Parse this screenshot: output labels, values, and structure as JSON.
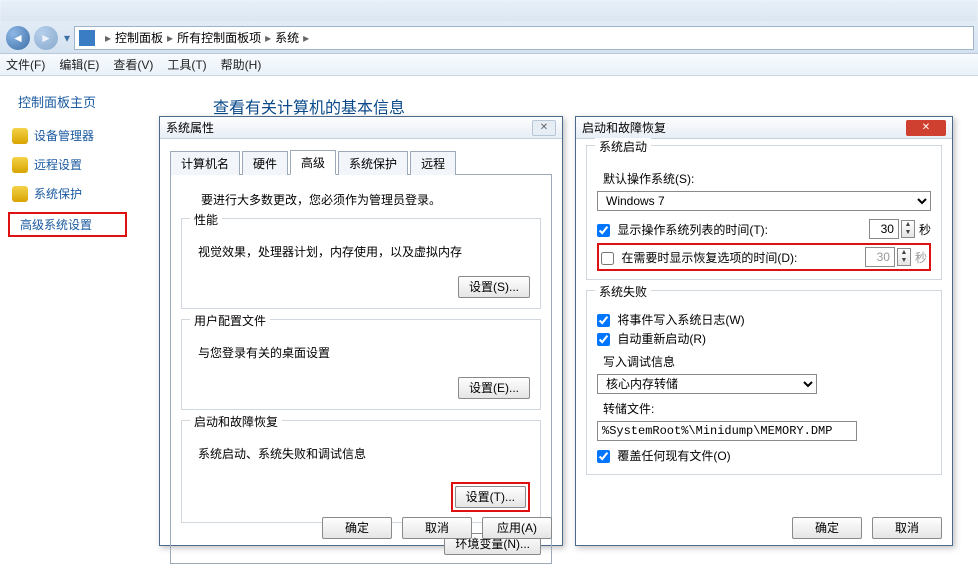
{
  "addrbar": {
    "seg1": "控制面板",
    "seg2": "所有控制面板项",
    "seg3": "系统"
  },
  "menu": {
    "file": "文件(F)",
    "edit": "编辑(E)",
    "view": "查看(V)",
    "tools": "工具(T)",
    "help": "帮助(H)"
  },
  "sidebar": {
    "title": "控制面板主页",
    "items": [
      "设备管理器",
      "远程设置",
      "系统保护",
      "高级系统设置"
    ]
  },
  "main": {
    "title": "查看有关计算机的基本信息"
  },
  "sysprop": {
    "title": "系统属性",
    "tabs": [
      "计算机名",
      "硬件",
      "高级",
      "系统保护",
      "远程"
    ],
    "note": "要进行大多数更改，您必须作为管理员登录。",
    "perf": {
      "legend": "性能",
      "desc": "视觉效果，处理器计划，内存使用，以及虚拟内存",
      "btn": "设置(S)..."
    },
    "user": {
      "legend": "用户配置文件",
      "desc": "与您登录有关的桌面设置",
      "btn": "设置(E)..."
    },
    "startup": {
      "legend": "启动和故障恢复",
      "desc": "系统启动、系统失败和调试信息",
      "btn": "设置(T)..."
    },
    "env_btn": "环境变量(N)...",
    "ok": "确定",
    "cancel": "取消",
    "apply": "应用(A)"
  },
  "startup": {
    "title": "启动和故障恢复",
    "boot": {
      "legend": "系统启动",
      "default_label": "默认操作系统(S):",
      "default_value": "Windows 7",
      "show_os_label": "显示操作系统列表的时间(T):",
      "show_os_value": "30",
      "sec": "秒",
      "show_rec_label": "在需要时显示恢复选项的时间(D):",
      "show_rec_value": "30"
    },
    "fail": {
      "legend": "系统失败",
      "log": "将事件写入系统日志(W)",
      "restart": "自动重新启动(R)",
      "dump_label": "写入调试信息",
      "dump_value": "核心内存转储",
      "file_label": "转储文件:",
      "file_value": "%SystemRoot%\\Minidump\\MEMORY.DMP",
      "overwrite": "覆盖任何现有文件(O)"
    },
    "ok": "确定",
    "cancel": "取消"
  }
}
